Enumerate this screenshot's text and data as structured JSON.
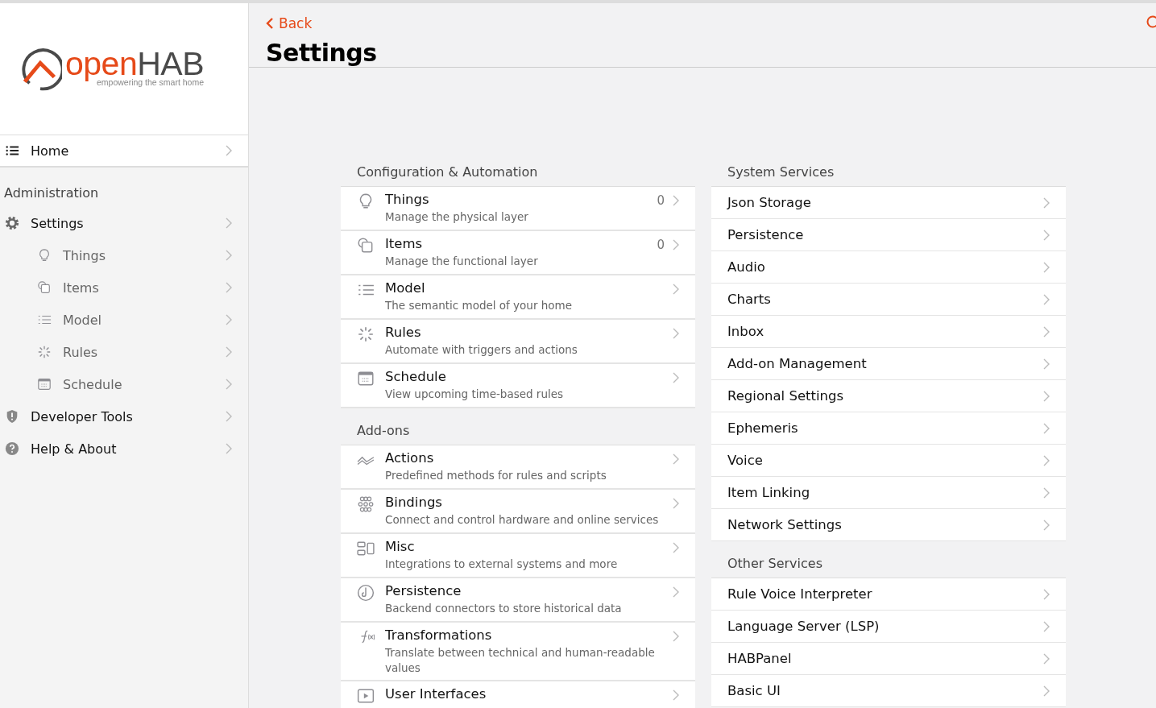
{
  "logo": {
    "brand_a": "open",
    "brand_b": "HAB",
    "tagline": "empowering the smart home"
  },
  "sidebar": {
    "home": {
      "label": "Home"
    },
    "section": "Administration",
    "items": [
      {
        "label": "Settings",
        "children": [
          {
            "label": "Things"
          },
          {
            "label": "Items"
          },
          {
            "label": "Model"
          },
          {
            "label": "Rules"
          },
          {
            "label": "Schedule"
          }
        ]
      },
      {
        "label": "Developer Tools"
      },
      {
        "label": "Help & About"
      }
    ]
  },
  "header": {
    "back": "Back",
    "title": "Settings"
  },
  "left_sections": [
    {
      "title": "Configuration & Automation",
      "items": [
        {
          "title": "Things",
          "subtitle": "Manage the physical layer",
          "count": "0"
        },
        {
          "title": "Items",
          "subtitle": "Manage the functional layer",
          "count": "0"
        },
        {
          "title": "Model",
          "subtitle": "The semantic model of your home"
        },
        {
          "title": "Rules",
          "subtitle": "Automate with triggers and actions"
        },
        {
          "title": "Schedule",
          "subtitle": "View upcoming time-based rules"
        }
      ]
    },
    {
      "title": "Add-ons",
      "items": [
        {
          "title": "Actions",
          "subtitle": "Predefined methods for rules and scripts"
        },
        {
          "title": "Bindings",
          "subtitle": "Connect and control hardware and online services"
        },
        {
          "title": "Misc",
          "subtitle": "Integrations to external systems and more"
        },
        {
          "title": "Persistence",
          "subtitle": "Backend connectors to store historical data"
        },
        {
          "title": "Transformations",
          "subtitle": "Translate between technical and human-readable values"
        },
        {
          "title": "User Interfaces"
        }
      ]
    }
  ],
  "right_sections": [
    {
      "title": "System Services",
      "items": [
        "Json Storage",
        "Persistence",
        "Audio",
        "Charts",
        "Inbox",
        "Add-on Management",
        "Regional Settings",
        "Ephemeris",
        "Voice",
        "Item Linking",
        "Network Settings"
      ]
    },
    {
      "title": "Other Services",
      "items": [
        "Rule Voice Interpreter",
        "Language Server (LSP)",
        "HABPanel",
        "Basic UI"
      ]
    }
  ]
}
